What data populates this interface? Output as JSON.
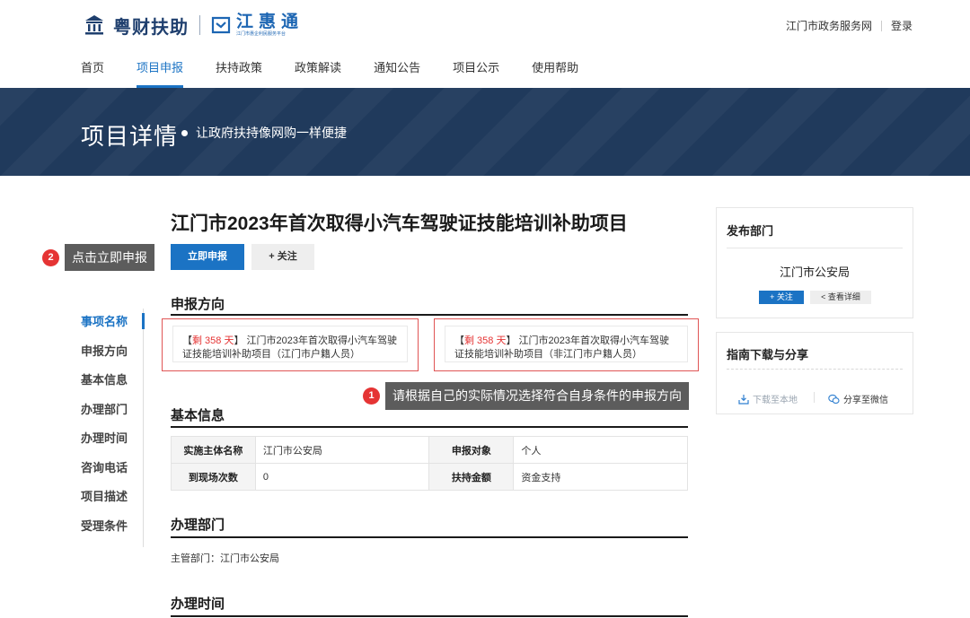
{
  "header": {
    "brand": "粤财扶助",
    "brand2": "江惠通",
    "brand2_sub": "江门市惠企利民服务平台",
    "top_links": [
      "江门市政务服务网",
      "登录"
    ]
  },
  "nav": {
    "items": [
      "首页",
      "项目申报",
      "扶持政策",
      "政策解读",
      "通知公告",
      "项目公示",
      "使用帮助"
    ],
    "active_index": 1
  },
  "banner": {
    "title": "项目详情",
    "subtitle": "让政府扶持像网购一样便捷"
  },
  "project": {
    "title": "江门市2023年首次取得小汽车驾驶证技能培训补助项目",
    "apply_label": "立即申报",
    "follow_label": "+ 关注"
  },
  "tips": {
    "tip1_num": "1",
    "tip1_text": "请根据自己的实际情况选择符合自身条件的申报方向",
    "tip2_num": "2",
    "tip2_text": "点击立即申报"
  },
  "side_nav": {
    "items": [
      "事项名称",
      "申报方向",
      "基本信息",
      "办理部门",
      "办理时间",
      "咨询电话",
      "项目描述",
      "受理条件"
    ],
    "active_index": 0
  },
  "direction": {
    "heading": "申报方向",
    "options": [
      {
        "prefix": "【",
        "days": "剩 358 天",
        "suffix": "】",
        "line1": "江门市2023年首次取得小汽车驾驶",
        "line2": "证技能培训补助项目（江门市户籍人员）"
      },
      {
        "prefix": "【",
        "days": "剩 358 天",
        "suffix": "】",
        "line1": "江门市2023年首次取得小汽车驾驶",
        "line2": "证技能培训补助项目（非江门市户籍人员）"
      }
    ]
  },
  "basic_info": {
    "heading": "基本信息",
    "rows": [
      [
        {
          "k": "实施主体名称",
          "v": "江门市公安局"
        },
        {
          "k": "申报对象",
          "v": "个人"
        }
      ],
      [
        {
          "k": "到现场次数",
          "v": "0"
        },
        {
          "k": "扶持金额",
          "v": "资金支持"
        }
      ]
    ]
  },
  "dept": {
    "heading": "办理部门",
    "text": "主管部门：江门市公安局"
  },
  "time": {
    "heading": "办理时间"
  },
  "publisher": {
    "heading": "发布部门",
    "name": "江门市公安局",
    "follow_label": "+ 关注",
    "detail_label": "< 查看详细"
  },
  "guide": {
    "heading": "指南下载与分享",
    "download_label": "下载至本地",
    "share_label": "分享至微信"
  },
  "colors": {
    "primary": "#1b73c4",
    "banner": "#203a5c",
    "highlight": "#e53434",
    "tip_bg": "#5c5c5c"
  }
}
